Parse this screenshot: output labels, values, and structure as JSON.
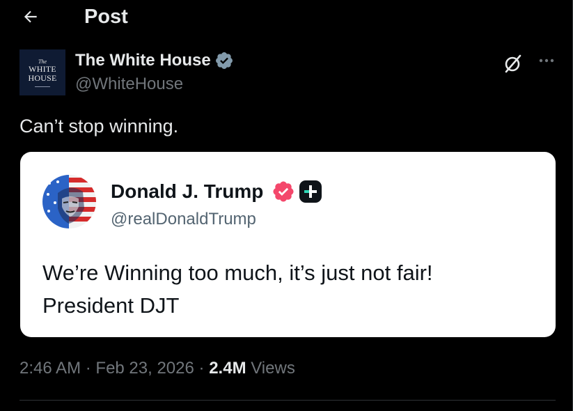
{
  "header": {
    "title": "Post",
    "back_icon": "arrow-left-icon"
  },
  "author": {
    "name": "The White House",
    "handle": "@WhiteHouse",
    "verified_badge_color": "#829aab",
    "avatar_logo": {
      "line1": "The",
      "line2": "WHITE",
      "line3": "HOUSE"
    },
    "actions": [
      "grok-icon",
      "more-icon"
    ]
  },
  "post": {
    "text": "Can’t stop winning."
  },
  "quote": {
    "name": "Donald J. Trump",
    "handle": "@realDonaldTrump",
    "badge_color": "#f4476b",
    "body_line1": "We’re Winning too much, it’s just not fair!",
    "body_line2": "President DJT"
  },
  "meta": {
    "time": "2:46 AM",
    "separator": "·",
    "date": "Feb 23, 2026",
    "views_count": "2.4M",
    "views_label": "Views"
  },
  "colors": {
    "background": "#000000",
    "text_primary": "#e7e9ea",
    "text_secondary": "#71767b",
    "divider": "#2f3336",
    "card_background": "#ffffff"
  }
}
